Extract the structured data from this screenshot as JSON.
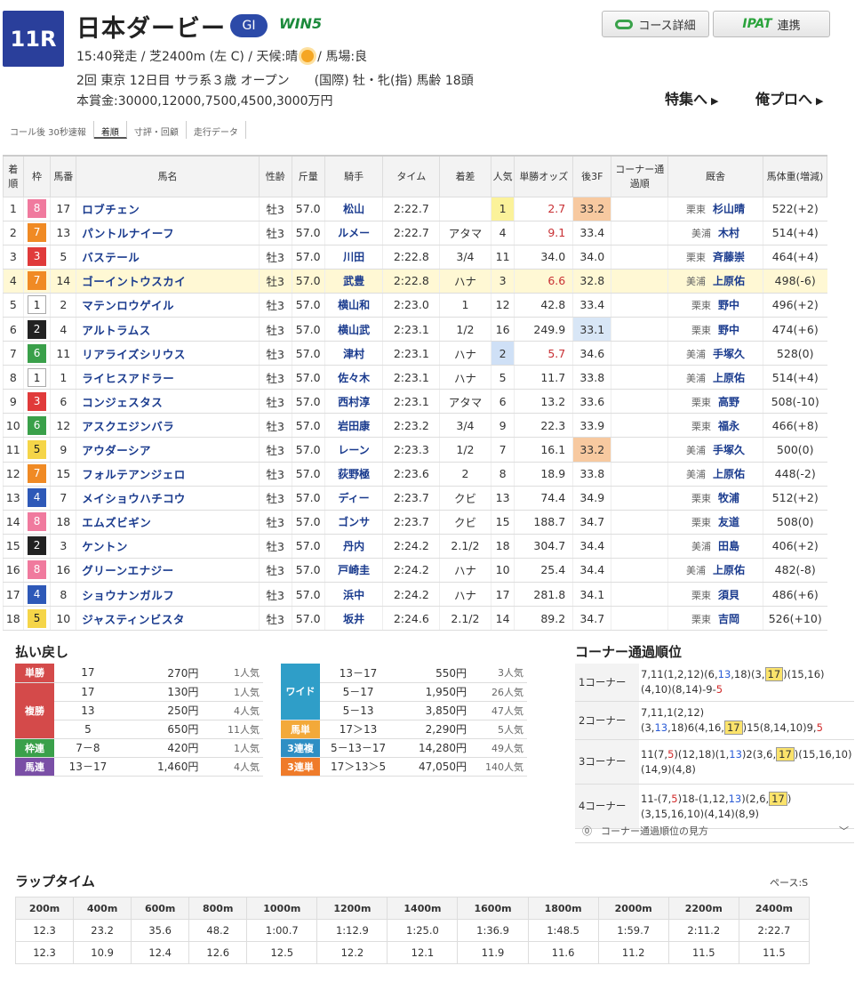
{
  "header": {
    "race_no": "11R",
    "race_name": "日本ダービー",
    "grade": "GI",
    "win5": "WIN5",
    "line1_a": "15:40発走 / 芝2400m (左 C) / 天候:晴",
    "line1_b": "/ 馬場:良",
    "line2": "2回 東京 12日目 サラ系３歳 オープン　　(国際) 牡・牝(指) 馬齢 18頭",
    "line3": "本賞金:30000,12000,7500,4500,3000万円",
    "course_btn": "コース詳細",
    "ipat_logo": "IPAT",
    "ipat_label": "連携",
    "special": "特集へ",
    "pro": "俺プロへ"
  },
  "tabs": [
    "コール後 30秒速報",
    "着順",
    "寸評・回顧",
    "走行データ"
  ],
  "columns": [
    "着順",
    "枠",
    "馬番",
    "馬名",
    "性齢",
    "斤量",
    "騎手",
    "タイム",
    "着差",
    "人気",
    "単勝オッズ",
    "後3F",
    "コーナー通過順",
    "厩舎",
    "馬体重(増減)"
  ],
  "rows": [
    [
      "1",
      "8",
      "17",
      "ロブチェン",
      "牡3",
      "57.0",
      "松山",
      "2:22.7",
      "",
      "1",
      "2.7",
      "33.2",
      "",
      "栗東",
      "杉山晴",
      "522(+2)"
    ],
    [
      "2",
      "7",
      "13",
      "パントルナイーフ",
      "牡3",
      "57.0",
      "ルメー",
      "2:22.7",
      "アタマ",
      "4",
      "9.1",
      "33.4",
      "",
      "美浦",
      "木村",
      "514(+4)"
    ],
    [
      "3",
      "3",
      "5",
      "バステール",
      "牡3",
      "57.0",
      "川田",
      "2:22.8",
      "3/4",
      "11",
      "34.0",
      "34.0",
      "",
      "栗東",
      "斉藤崇",
      "464(+4)"
    ],
    [
      "4",
      "7",
      "14",
      "ゴーイントウスカイ",
      "牡3",
      "57.0",
      "武豊",
      "2:22.8",
      "ハナ",
      "3",
      "6.6",
      "32.8",
      "",
      "美浦",
      "上原佑",
      "498(-6)"
    ],
    [
      "5",
      "1",
      "2",
      "マテンロウゲイル",
      "牡3",
      "57.0",
      "横山和",
      "2:23.0",
      "1",
      "12",
      "42.8",
      "33.4",
      "",
      "栗東",
      "野中",
      "496(+2)"
    ],
    [
      "6",
      "2",
      "4",
      "アルトラムス",
      "牡3",
      "57.0",
      "横山武",
      "2:23.1",
      "1/2",
      "16",
      "249.9",
      "33.1",
      "",
      "栗東",
      "野中",
      "474(+6)"
    ],
    [
      "7",
      "6",
      "11",
      "リアライズシリウス",
      "牡3",
      "57.0",
      "津村",
      "2:23.1",
      "ハナ",
      "2",
      "5.7",
      "34.6",
      "",
      "美浦",
      "手塚久",
      "528(0)"
    ],
    [
      "8",
      "1",
      "1",
      "ライヒスアドラー",
      "牡3",
      "57.0",
      "佐々木",
      "2:23.1",
      "ハナ",
      "5",
      "11.7",
      "33.8",
      "",
      "美浦",
      "上原佑",
      "514(+4)"
    ],
    [
      "9",
      "3",
      "6",
      "コンジェスタス",
      "牡3",
      "57.0",
      "西村淳",
      "2:23.1",
      "アタマ",
      "6",
      "13.2",
      "33.6",
      "",
      "栗東",
      "高野",
      "508(-10)"
    ],
    [
      "10",
      "6",
      "12",
      "アスクエジンバラ",
      "牡3",
      "57.0",
      "岩田康",
      "2:23.2",
      "3/4",
      "9",
      "22.3",
      "33.9",
      "",
      "栗東",
      "福永",
      "466(+8)"
    ],
    [
      "11",
      "5",
      "9",
      "アウダーシア",
      "牡3",
      "57.0",
      "レーン",
      "2:23.3",
      "1/2",
      "7",
      "16.1",
      "33.2",
      "",
      "美浦",
      "手塚久",
      "500(0)"
    ],
    [
      "12",
      "7",
      "15",
      "フォルテアンジェロ",
      "牡3",
      "57.0",
      "荻野極",
      "2:23.6",
      "2",
      "8",
      "18.9",
      "33.8",
      "",
      "美浦",
      "上原佑",
      "448(-2)"
    ],
    [
      "13",
      "4",
      "7",
      "メイショウハチコウ",
      "牡3",
      "57.0",
      "ディー",
      "2:23.7",
      "クビ",
      "13",
      "74.4",
      "34.9",
      "",
      "栗東",
      "牧浦",
      "512(+2)"
    ],
    [
      "14",
      "8",
      "18",
      "エムズビギン",
      "牡3",
      "57.0",
      "ゴンサ",
      "2:23.7",
      "クビ",
      "15",
      "188.7",
      "34.7",
      "",
      "栗東",
      "友道",
      "508(0)"
    ],
    [
      "15",
      "2",
      "3",
      "ケントン",
      "牡3",
      "57.0",
      "丹内",
      "2:24.2",
      "2.1/2",
      "18",
      "304.7",
      "34.4",
      "",
      "美浦",
      "田島",
      "406(+2)"
    ],
    [
      "16",
      "8",
      "16",
      "グリーンエナジー",
      "牡3",
      "57.0",
      "戸崎圭",
      "2:24.2",
      "ハナ",
      "10",
      "25.4",
      "34.4",
      "",
      "美浦",
      "上原佑",
      "482(-8)"
    ],
    [
      "17",
      "4",
      "8",
      "ショウナンガルフ",
      "牡3",
      "57.0",
      "浜中",
      "2:24.2",
      "ハナ",
      "17",
      "281.8",
      "34.1",
      "",
      "栗東",
      "須貝",
      "486(+6)"
    ],
    [
      "18",
      "5",
      "10",
      "ジャスティンビスタ",
      "牡3",
      "57.0",
      "坂井",
      "2:24.6",
      "2.1/2",
      "14",
      "89.2",
      "34.7",
      "",
      "栗東",
      "吉岡",
      "526(+10)"
    ]
  ],
  "waku_colors": {
    "1": "#ffffff",
    "2": "#222222",
    "3": "#e03a3a",
    "4": "#2e59b8",
    "5": "#f5d548",
    "6": "#3aa04a",
    "7": "#f08a24",
    "8": "#f07a9e"
  },
  "payout_title": "払い戻し",
  "payout_left": [
    [
      "単勝",
      "17",
      "270円",
      "1人気"
    ],
    [
      "",
      "17",
      "130円",
      "1人気"
    ],
    [
      "複勝",
      "13",
      "250円",
      "4人気"
    ],
    [
      "",
      "5",
      "650円",
      "11人気"
    ],
    [
      "枠連",
      "7－8",
      "420円",
      "1人気"
    ],
    [
      "馬連",
      "13－17",
      "1,460円",
      "4人気"
    ]
  ],
  "payout_right": [
    [
      "",
      "13－17",
      "550円",
      "3人気"
    ],
    [
      "ワイド",
      "5－17",
      "1,950円",
      "26人気"
    ],
    [
      "",
      "5－13",
      "3,850円",
      "47人気"
    ],
    [
      "馬単",
      "17＞13",
      "2,290円",
      "5人気"
    ],
    [
      "3連複",
      "5－13－17",
      "14,280円",
      "49人気"
    ],
    [
      "3連単",
      "17＞13＞5",
      "47,050円",
      "140人気"
    ]
  ],
  "payout_label_colors": {
    "単勝": "#d44a4a",
    "複勝": "#d44a4a",
    "枠連": "#3aa04a",
    "馬連": "#7a4fa6",
    "ワイド": "#2f9ec8",
    "馬単": "#f3a93a",
    "3連複": "#2f8fc4",
    "3連単": "#ef7b2a"
  },
  "corner_title": "コーナー通過順位",
  "corners": [
    "1コーナー",
    "2コーナー",
    "3コーナー",
    "4コーナー"
  ],
  "corner_help": "コーナー通過順位の見方",
  "lap_title": "ラップタイム",
  "pace": "ペース:S",
  "lap_dist": [
    "200m",
    "400m",
    "600m",
    "800m",
    "1000m",
    "1200m",
    "1400m",
    "1600m",
    "1800m",
    "2000m",
    "2200m",
    "2400m"
  ],
  "lap_cum": [
    "12.3",
    "23.2",
    "35.6",
    "48.2",
    "1:00.7",
    "1:12.9",
    "1:25.0",
    "1:36.9",
    "1:48.5",
    "1:59.7",
    "2:11.2",
    "2:22.7"
  ],
  "lap_split": [
    "12.3",
    "10.9",
    "12.4",
    "12.6",
    "12.5",
    "12.2",
    "12.1",
    "11.9",
    "11.6",
    "11.2",
    "11.5",
    "11.5"
  ]
}
